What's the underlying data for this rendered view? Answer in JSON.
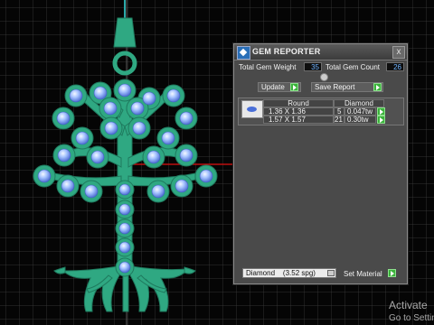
{
  "panel": {
    "title": "GEM REPORTER",
    "close_glyph": "x",
    "total_gem_weight_label": "Total Gem Weight",
    "total_gem_weight_value": "35",
    "total_gem_count_label": "Total Gem Count",
    "total_gem_count_value": "26",
    "update_label": "Update",
    "save_report_label": "Save Report",
    "table": {
      "headers": [
        "Round",
        "Diamond"
      ],
      "rows": [
        {
          "size": "1.36 X 1.36",
          "count": "5",
          "weight": "0.047tw"
        },
        {
          "size": "1.57 X 1.57",
          "count": "21",
          "weight": "0.30tw"
        }
      ]
    },
    "material_select": "Diamond    (3.52 spg)",
    "set_material_label": "Set Material"
  },
  "icons": {
    "app": "gem-reporter-icon",
    "close": "close-icon",
    "gem": "gem-thumbnail-icon",
    "dropdown": "chevron-down-icon"
  },
  "colors": {
    "pendant": "#2fa882",
    "gem": "#8fb3f5",
    "grid": "#3f3f3f",
    "axis_red": "#e01010",
    "accent_green": "#3bb33b",
    "value_blue": "#6fb3ff"
  },
  "watermark": {
    "line1": "Activate",
    "line2": "Go to Settin"
  }
}
